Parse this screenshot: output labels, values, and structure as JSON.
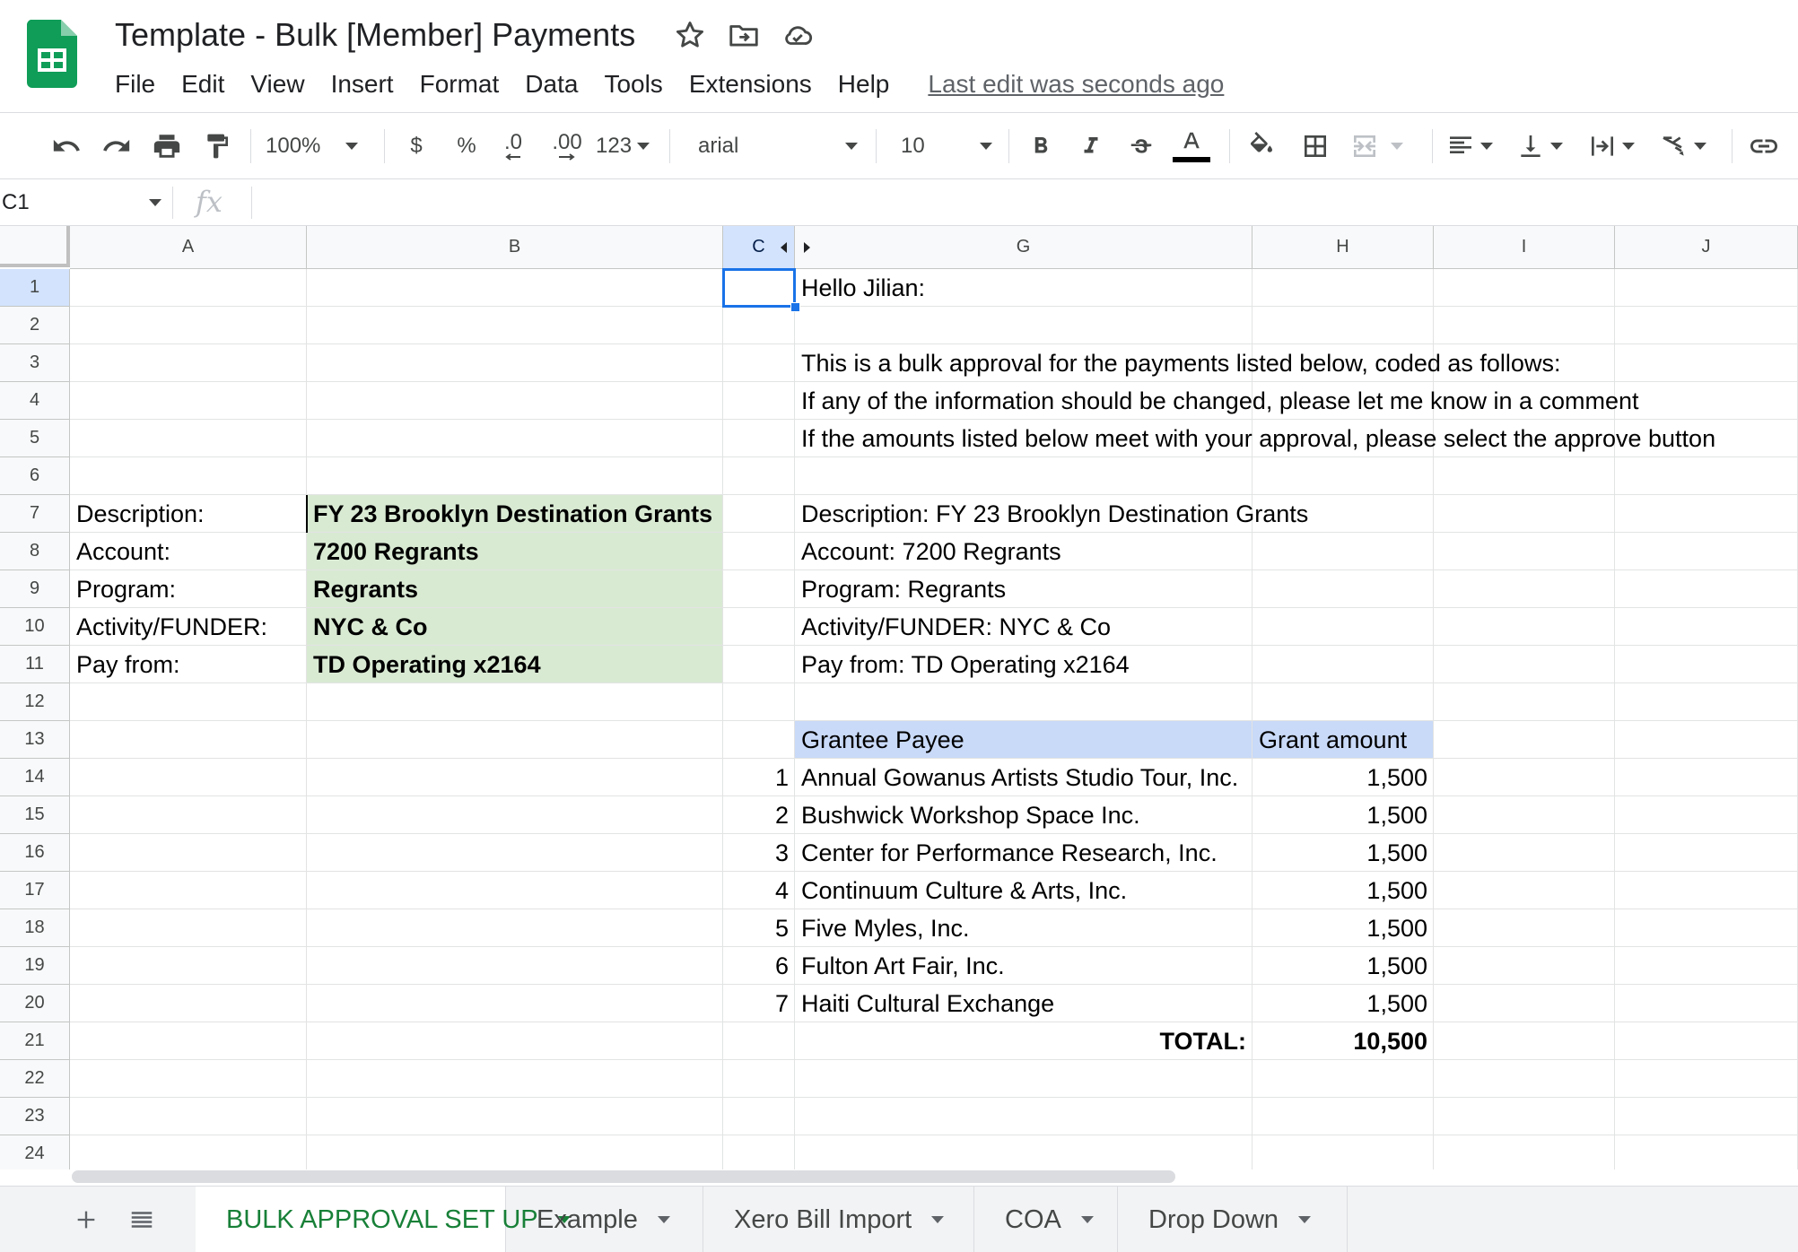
{
  "app": {
    "title": "Template - Bulk [Member] Payments",
    "last_edit": "Last edit was seconds ago",
    "brand_color": "#0f9d58"
  },
  "menu": [
    "File",
    "Edit",
    "View",
    "Insert",
    "Format",
    "Data",
    "Tools",
    "Extensions",
    "Help"
  ],
  "toolbar": {
    "zoom": "100%",
    "currency": "$",
    "percent": "%",
    "decrease_decimal": ".0",
    "increase_decimal": ".00",
    "more_formats": "123",
    "font": "arial",
    "font_size": "10",
    "icons": [
      "undo-icon",
      "redo-icon",
      "print-icon",
      "paint-format-icon",
      "bold-icon",
      "italic-icon",
      "strikethrough-icon",
      "text-color-icon",
      "fill-color-icon",
      "borders-icon",
      "merge-cells-icon",
      "horizontal-align-icon",
      "vertical-align-icon",
      "text-wrap-icon",
      "text-rotation-icon",
      "insert-link-icon"
    ]
  },
  "formula_bar": {
    "name_box": "C1",
    "fx": "fx",
    "formula": ""
  },
  "columns": [
    "A",
    "B",
    "C",
    "G",
    "H",
    "I",
    "J"
  ],
  "rows": [
    "1",
    "2",
    "3",
    "4",
    "5",
    "6",
    "7",
    "8",
    "9",
    "10",
    "11",
    "12",
    "13",
    "14",
    "15",
    "16",
    "17",
    "18",
    "19",
    "20",
    "21",
    "22",
    "23",
    "24"
  ],
  "cells": {
    "G1": "Hello Jilian:",
    "G3": "This is a bulk approval for the payments listed below, coded as follows:",
    "G4": "If any of the information should be changed, please let me know in a comment",
    "G5": "If the amounts listed below meet with your approval, please select the approve button",
    "A7": "Description:",
    "A8": "Account:",
    "A9": "Program:",
    "A10": "Activity/FUNDER:",
    "A11": "Pay from:",
    "B7": "FY 23 Brooklyn Destination Grants",
    "B8": "7200 Regrants",
    "B9": "Regrants",
    "B10": "NYC & Co",
    "B11": "TD Operating x2164",
    "G7": "Description:  FY 23 Brooklyn Destination Grants",
    "G8": "Account:  7200 Regrants",
    "G9": "Program:  Regrants",
    "G10": "Activity/FUNDER:  NYC & Co",
    "G11": "Pay from:  TD Operating x2164",
    "G13": "Grantee Payee",
    "H13": "Grant amount",
    "G21": "TOTAL:",
    "H21": "10,500"
  },
  "grants": [
    {
      "num": "1",
      "payee": "Annual Gowanus Artists Studio Tour, Inc.",
      "amount": "1,500"
    },
    {
      "num": "2",
      "payee": "Bushwick Workshop Space Inc.",
      "amount": "1,500"
    },
    {
      "num": "3",
      "payee": "Center for Performance Research, Inc.",
      "amount": "1,500"
    },
    {
      "num": "4",
      "payee": "Continuum Culture & Arts, Inc.",
      "amount": "1,500"
    },
    {
      "num": "5",
      "payee": "Five Myles, Inc.",
      "amount": "1,500"
    },
    {
      "num": "6",
      "payee": "Fulton Art Fair, Inc.",
      "amount": "1,500"
    },
    {
      "num": "7",
      "payee": "Haiti Cultural Exchange",
      "amount": "1,500"
    }
  ],
  "colors": {
    "input_fill": "#d9ead3",
    "header_fill": "#c9daf8",
    "selection": "#1a73e8",
    "active_tab": "#188038"
  },
  "sheet_tabs": [
    {
      "label": "BULK APPROVAL SET UP",
      "active": true
    },
    {
      "label": "Example",
      "active": false
    },
    {
      "label": "Xero Bill Import",
      "active": false
    },
    {
      "label": "COA",
      "active": false
    },
    {
      "label": "Drop Down",
      "active": false
    }
  ]
}
